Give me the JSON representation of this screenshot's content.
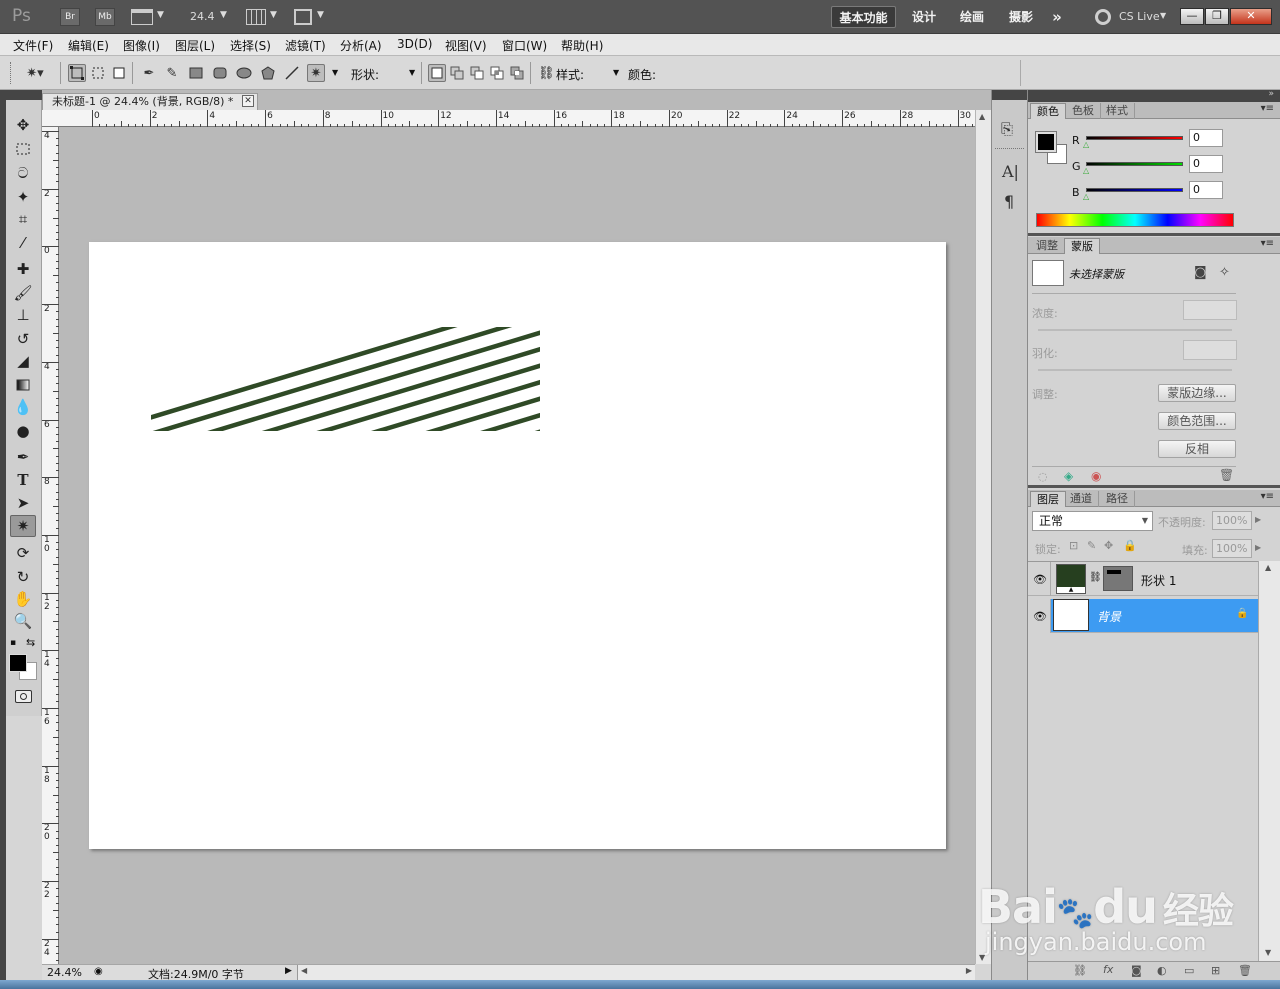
{
  "app": {
    "logo": "Ps",
    "bridge": "Br",
    "minibridge": "Mb",
    "zoom_value": "24.4",
    "workspaces": [
      "基本功能",
      "设计",
      "绘画",
      "摄影"
    ],
    "workspace_more": "»",
    "cslive": "CS Live"
  },
  "menu": [
    "文件(F)",
    "编辑(E)",
    "图像(I)",
    "图层(L)",
    "选择(S)",
    "滤镜(T)",
    "分析(A)",
    "3D(D)",
    "视图(V)",
    "窗口(W)",
    "帮助(H)"
  ],
  "options": {
    "shape_label": "形状:",
    "style_label": "样式:",
    "color_label": "颜色:",
    "color_value": "#000000"
  },
  "document": {
    "tab_title": "未标题-1 @ 24.4% (背景, RGB/8) *",
    "ruler_h": [
      "0",
      "2",
      "4",
      "6",
      "8",
      "10",
      "12",
      "14",
      "16",
      "18",
      "20",
      "22",
      "24",
      "26",
      "28",
      "30"
    ],
    "ruler_v": [
      "4",
      "2",
      "0",
      "2",
      "4",
      "6",
      "8",
      "1\n0",
      "1\n2",
      "1\n4",
      "1\n6",
      "1\n8",
      "2\n0",
      "2\n2",
      "2\n4"
    ],
    "stripe_color": "#2f4a26"
  },
  "status": {
    "zoom": "24.4%",
    "doc_info": "文档:24.9M/0 字节"
  },
  "color_panel": {
    "tabs": [
      "颜色",
      "色板",
      "样式"
    ],
    "channels": [
      {
        "label": "R",
        "value": "0"
      },
      {
        "label": "G",
        "value": "0"
      },
      {
        "label": "B",
        "value": "0"
      }
    ]
  },
  "masks_panel": {
    "tabs": [
      "调整",
      "蒙版"
    ],
    "no_mask": "未选择蒙版",
    "density_label": "浓度:",
    "feather_label": "羽化:",
    "refine_label": "调整:",
    "btn_mask_edge": "蒙版边缘...",
    "btn_color_range": "颜色范围...",
    "btn_invert": "反相"
  },
  "layers_panel": {
    "tabs": [
      "图层",
      "通道",
      "路径"
    ],
    "blend_mode": "正常",
    "opacity_label": "不透明度:",
    "opacity_value": "100%",
    "lock_label": "锁定:",
    "fill_label": "填充:",
    "fill_value": "100%",
    "layers": [
      {
        "name": "形状 1",
        "thumb_color": "#263f1f"
      },
      {
        "name": "背景",
        "thumb_color": "#ffffff"
      }
    ]
  },
  "watermark": {
    "brand_a": "Bai",
    "brand_b": "du",
    "brand_c": "经验",
    "url": "jingyan.baidu.com"
  }
}
